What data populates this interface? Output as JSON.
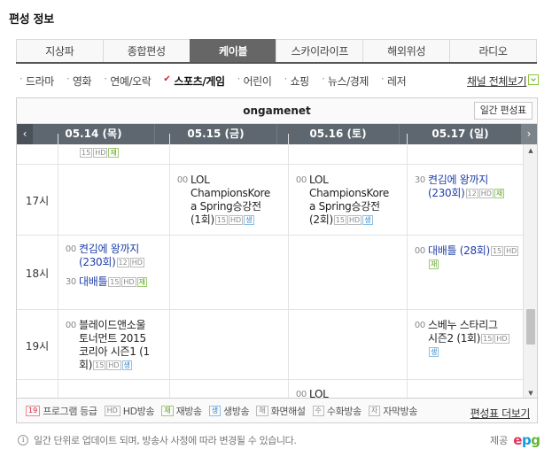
{
  "page_title": "편성 정보",
  "tabs": [
    "지상파",
    "종합편성",
    "케이블",
    "스카이라이프",
    "해외위성",
    "라디오"
  ],
  "active_tab": 2,
  "subcats": [
    "드라마",
    "영화",
    "연예/오락",
    "스포츠/게임",
    "어린이",
    "쇼핑",
    "뉴스/경제",
    "레저"
  ],
  "active_subcat": 3,
  "all_channels_label": "채널 전체보기",
  "channel_name": "ongamenet",
  "guide_button": "일간 편성표",
  "nav_prev": "‹",
  "nav_next": "›",
  "dates": [
    "05.14 (목)",
    "05.15 (금)",
    "05.16 (토)",
    "05.17 (일)"
  ],
  "rows": [
    {
      "time": "",
      "cells": [
        [
          {
            "min": "",
            "lines": [
              ""
            ],
            "link": false,
            "badges": [
              {
                "t": "15",
                "k": ""
              },
              {
                "t": "HD",
                "k": ""
              },
              {
                "t": "재",
                "k": "re"
              }
            ]
          }
        ],
        [],
        [],
        []
      ]
    },
    {
      "time": "17시",
      "cells": [
        [],
        [
          {
            "min": "00",
            "lines": [
              "LOL",
              "ChampionsKore",
              "a Spring승강전",
              "(1회)"
            ],
            "link": false,
            "badges": [
              {
                "t": "15",
                "k": ""
              },
              {
                "t": "HD",
                "k": ""
              },
              {
                "t": "생",
                "k": "live"
              }
            ]
          }
        ],
        [
          {
            "min": "00",
            "lines": [
              "LOL",
              "ChampionsKore",
              "a Spring승강전",
              "(2회)"
            ],
            "link": false,
            "badges": [
              {
                "t": "15",
                "k": ""
              },
              {
                "t": "HD",
                "k": ""
              },
              {
                "t": "생",
                "k": "live"
              }
            ]
          }
        ],
        [
          {
            "min": "30",
            "lines": [
              "켠김에 왕까지",
              "(230회)"
            ],
            "link": true,
            "badges": [
              {
                "t": "12",
                "k": ""
              },
              {
                "t": "HD",
                "k": ""
              },
              {
                "t": "재",
                "k": "re"
              }
            ]
          }
        ]
      ]
    },
    {
      "time": "18시",
      "cells": [
        [
          {
            "min": "00",
            "lines": [
              "켠김에 왕까지",
              "(230회)"
            ],
            "link": true,
            "badges": [
              {
                "t": "12",
                "k": ""
              },
              {
                "t": "HD",
                "k": ""
              }
            ]
          },
          {
            "min": "30",
            "lines": [
              "대배틀"
            ],
            "link": true,
            "badges": [
              {
                "t": "15",
                "k": ""
              },
              {
                "t": "HD",
                "k": ""
              },
              {
                "t": "재",
                "k": "re"
              }
            ]
          }
        ],
        [],
        [],
        [
          {
            "min": "00",
            "lines": [
              "대배틀 (28회)"
            ],
            "link": true,
            "badges": [
              {
                "t": "15",
                "k": ""
              },
              {
                "t": "HD",
                "k": ""
              },
              {
                "t": "재",
                "k": "re"
              }
            ]
          }
        ]
      ]
    },
    {
      "time": "19시",
      "cells": [
        [
          {
            "min": "00",
            "lines": [
              "블레이드앤소울",
              "토너먼트 2015",
              "코리아 시즌1 (1",
              "회)"
            ],
            "link": false,
            "badges": [
              {
                "t": "15",
                "k": ""
              },
              {
                "t": "HD",
                "k": ""
              },
              {
                "t": "생",
                "k": "live"
              }
            ]
          }
        ],
        [],
        [],
        [
          {
            "min": "00",
            "lines": [
              "스베누 스타리그",
              "시즌2 (1회)"
            ],
            "link": false,
            "badges": [
              {
                "t": "15",
                "k": ""
              },
              {
                "t": "HD",
                "k": ""
              },
              {
                "t": "생",
                "k": "live"
              }
            ]
          }
        ]
      ]
    },
    {
      "time": "",
      "cells": [
        [],
        [],
        [
          {
            "min": "00",
            "lines": [
              "LOL"
            ],
            "link": false,
            "badges": []
          }
        ],
        []
      ]
    }
  ],
  "legend": [
    {
      "badge": "19",
      "label": "프로그램 등급",
      "kind": "age"
    },
    {
      "badge": "HD",
      "label": "HD방송",
      "kind": ""
    },
    {
      "badge": "재",
      "label": "재방송",
      "kind": "re"
    },
    {
      "badge": "생",
      "label": "생방송",
      "kind": "live"
    },
    {
      "badge": "해",
      "label": "화면해설",
      "kind": ""
    },
    {
      "badge": "수",
      "label": "수화방송",
      "kind": ""
    },
    {
      "badge": "자",
      "label": "자막방송",
      "kind": ""
    }
  ],
  "more_guide": "편성표 더보기",
  "notice": "일간 단위로 업데이트 되며, 방송사 사정에 따라 변경될 수 있습니다.",
  "provider_label": "제공",
  "provider_logo": {
    "e": "e",
    "p": "p",
    "g": "g"
  },
  "colors": {
    "active_tab": "#666666",
    "date_bar": "#5e6770",
    "link": "#1f3fa8",
    "check": "#d6203a"
  }
}
